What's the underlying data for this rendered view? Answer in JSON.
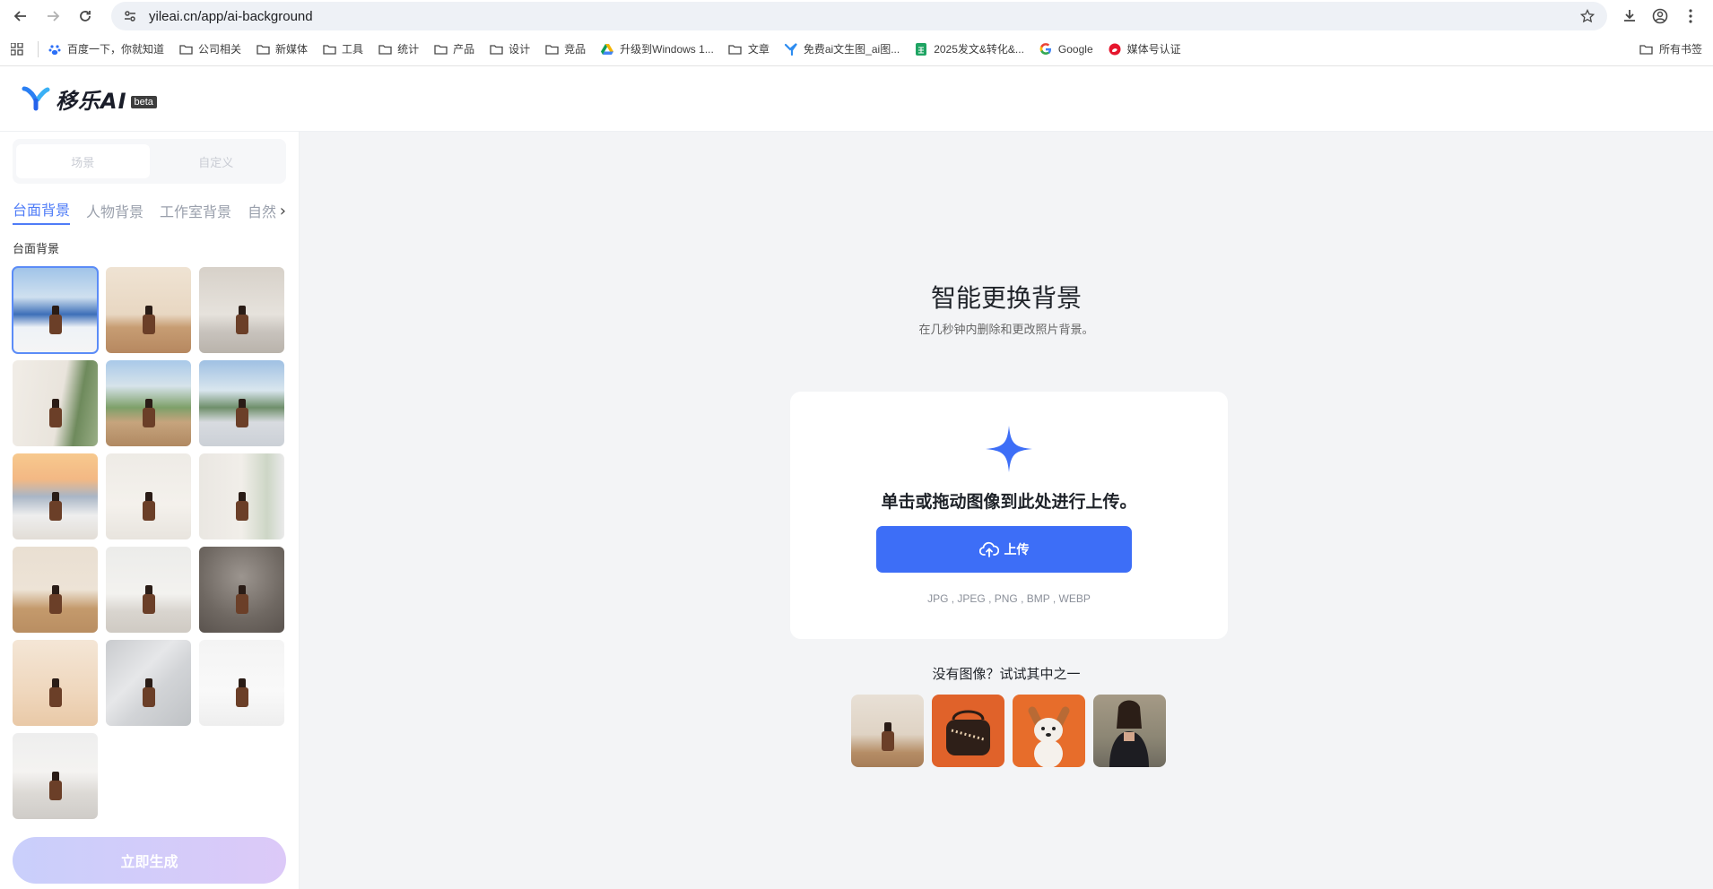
{
  "browser": {
    "url": "yileai.cn/app/ai-background",
    "bookmarks": [
      {
        "label": "百度一下，你就知道",
        "icon": "baidu-icon"
      },
      {
        "label": "公司相关",
        "icon": "folder-icon"
      },
      {
        "label": "新媒体",
        "icon": "folder-icon"
      },
      {
        "label": "工具",
        "icon": "folder-icon"
      },
      {
        "label": "统计",
        "icon": "folder-icon"
      },
      {
        "label": "产品",
        "icon": "folder-icon"
      },
      {
        "label": "设计",
        "icon": "folder-icon"
      },
      {
        "label": "竞品",
        "icon": "folder-icon"
      },
      {
        "label": "升级到Windows 1...",
        "icon": "google-drive-icon"
      },
      {
        "label": "文章",
        "icon": "folder-icon"
      },
      {
        "label": "免费ai文生图_ai图...",
        "icon": "yile-icon"
      },
      {
        "label": "2025发文&转化&...",
        "icon": "sheets-icon"
      },
      {
        "label": "Google",
        "icon": "google-icon"
      },
      {
        "label": "媒体号认证",
        "icon": "weibo-icon"
      }
    ],
    "all_bookmarks": "所有书签"
  },
  "app": {
    "logo_text": "移乐AI",
    "beta": "beta"
  },
  "sidebar": {
    "segments": [
      "场景",
      "自定义"
    ],
    "categories": [
      "台面背景",
      "人物背景",
      "工作室背景",
      "自然"
    ],
    "section_title": "台面背景",
    "generate_label": "立即生成"
  },
  "main": {
    "title": "智能更换背景",
    "subtitle": "在几秒钟内删除和更改照片背景。",
    "upload_text": "单击或拖动图像到此处进行上传。",
    "upload_button": "上传",
    "formats": "JPG , JPEG , PNG , BMP , WEBP",
    "try_text": "没有图像？试试其中之一"
  },
  "colors": {
    "accent": "#3d6ef7",
    "tab_active": "#4f7cf7"
  }
}
